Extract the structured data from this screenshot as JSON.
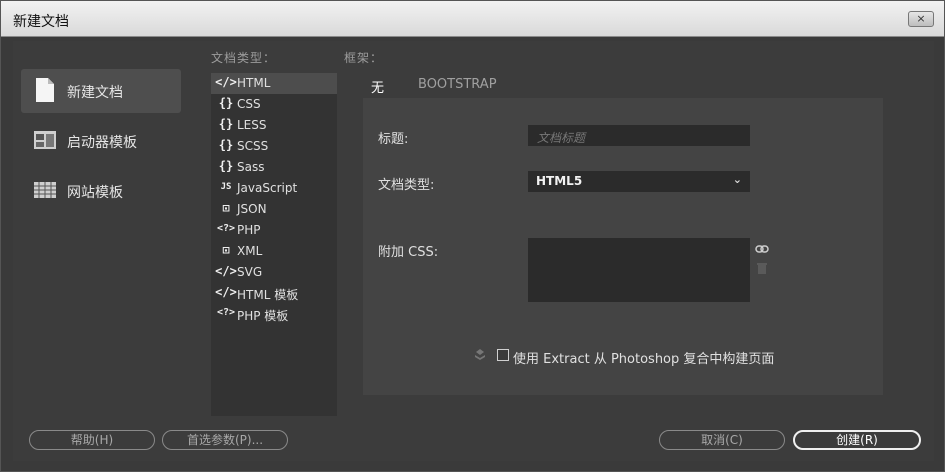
{
  "window": {
    "title": "新建文档",
    "close": "×"
  },
  "categories": [
    {
      "label": "新建文档",
      "icon": "blank-document-icon"
    },
    {
      "label": "启动器模板",
      "icon": "starter-template-icon"
    },
    {
      "label": "网站模板",
      "icon": "site-template-icon"
    }
  ],
  "headers": {
    "doc_type": "文档类型：",
    "framework": "框架："
  },
  "doc_types": [
    {
      "glyph": "</>",
      "label": "HTML"
    },
    {
      "glyph": "{}",
      "label": "CSS"
    },
    {
      "glyph": "{}",
      "label": "LESS"
    },
    {
      "glyph": "{}",
      "label": "SCSS"
    },
    {
      "glyph": "{}",
      "label": "Sass"
    },
    {
      "glyph": "JS",
      "label": "JavaScript"
    },
    {
      "glyph": "⊡",
      "label": "JSON"
    },
    {
      "glyph": "<?>",
      "label": "PHP"
    },
    {
      "glyph": "⊡",
      "label": "XML"
    },
    {
      "glyph": "</>",
      "label": "SVG"
    },
    {
      "glyph": "</>",
      "label": "HTML 模板"
    },
    {
      "glyph": "<?>",
      "label": "PHP 模板"
    }
  ],
  "tabs": {
    "none": "无",
    "bootstrap": "BOOTSTRAP"
  },
  "form": {
    "title_label": "标题:",
    "title_placeholder": "文档标题",
    "doctype_label": "文档类型:",
    "doctype_value": "HTML5",
    "css_label": "附加 CSS:",
    "extract_text": "使用 Extract 从 Photoshop 复合中构建页面"
  },
  "buttons": {
    "help": "帮助(H)",
    "prefs": "首选参数(P)...",
    "cancel": "取消(C)",
    "create": "创建(R)"
  }
}
